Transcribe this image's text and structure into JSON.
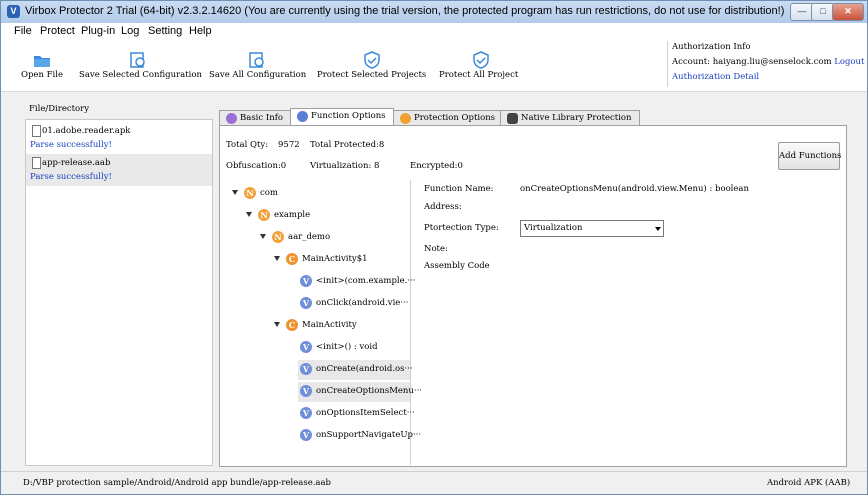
{
  "window": {
    "title": "Virbox Protector 2 Trial (64-bit) v2.3.2.14620 (You are currently using the trial version, the protected program has run restrictions, do not use for distribution!)",
    "app_icon_letter": "V"
  },
  "menu": [
    "File",
    "Protect",
    "Plug-in",
    "Log",
    "Setting",
    "Help"
  ],
  "toolbar": {
    "open_file": "Open File",
    "save_selected": "Save Selected Configuration",
    "save_all": "Save All Configuration",
    "protect_selected": "Protect Selected Projects",
    "protect_all": "Protect All Project"
  },
  "auth": {
    "heading": "Authorization Info",
    "account": "Account: haiyang.liu@senselock.com",
    "logout": "Logout",
    "detail": "Authorization Detail"
  },
  "left_panel": {
    "label": "File/Directory",
    "files": [
      {
        "name": "01.adobe.reader.apk",
        "status": "Parse successfully!"
      },
      {
        "name": "app-release.aab",
        "status": "Parse successfully!"
      }
    ]
  },
  "tabs": [
    "Basic Info",
    "Function Options",
    "Protection Options",
    "Native Library Protection"
  ],
  "stats": {
    "total_qty_label": "Total Qty:",
    "total_qty_value": "9572",
    "total_protected": "Total Protected:8",
    "obfuscation": "Obfuscation:0",
    "virtualization": "Virtualization: 8",
    "encrypted": "Encrypted:0"
  },
  "add_functions": "Add Functions",
  "tree": [
    {
      "label": "com",
      "type": "N"
    },
    {
      "label": "example",
      "type": "N"
    },
    {
      "label": "aar_demo",
      "type": "N"
    },
    {
      "label": "MainActivity$1",
      "type": "C"
    },
    {
      "label": "<init>(com.example.···",
      "type": "V"
    },
    {
      "label": "onClick(android.vie···",
      "type": "V"
    },
    {
      "label": "MainActivity",
      "type": "C"
    },
    {
      "label": "<init>() : void",
      "type": "V"
    },
    {
      "label": "onCreate(android.os···",
      "type": "V"
    },
    {
      "label": "onCreateOptionsMenu···",
      "type": "V"
    },
    {
      "label": "onOptionsItemSelect···",
      "type": "V"
    },
    {
      "label": "onSupportNavigateUp···",
      "type": "V"
    }
  ],
  "details": {
    "function_name_label": "Function Name:",
    "function_name_value": "onCreateOptionsMenu(android.view.Menu) : boolean",
    "address_label": "Address:",
    "ptype_label": "Ptortection Type:",
    "ptype_value": "Virtualization",
    "note_label": "Note:",
    "assembly_label": "Assembly Code"
  },
  "status": {
    "path": "D:/VBP protection sample/Android/Android app bundle/app-release.aab",
    "mode": "Android APK (AAB)"
  },
  "colors": {
    "title_bar": "#b3cbe9",
    "link": "#1a3fbf",
    "package_badge": "#f2a23a",
    "method_badge": "#6f8fd8"
  }
}
